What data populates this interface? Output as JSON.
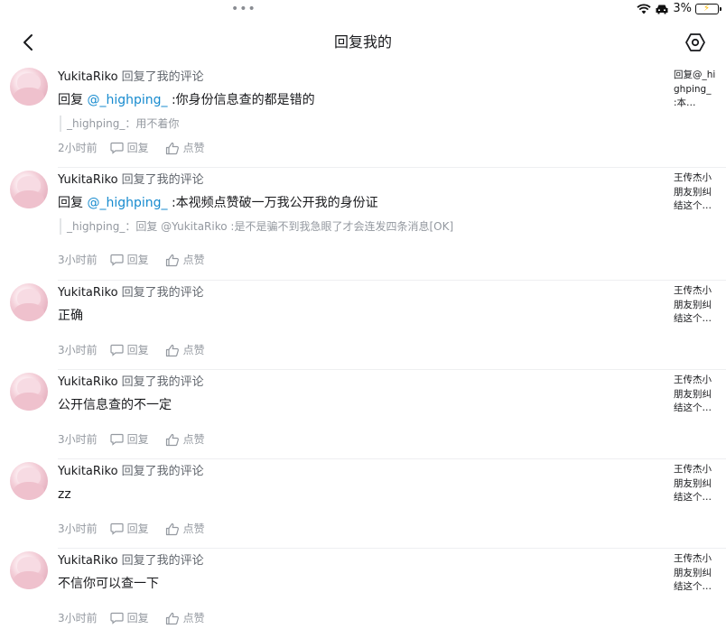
{
  "status_bar": {
    "battery_text": "3%"
  },
  "header": {
    "title": "回复我的"
  },
  "replies": [
    {
      "name": "YukitaRiko",
      "action": "回复了我的评论",
      "prefix": "回复 ",
      "mention": "@_highping_",
      "text": " :你身份信息查的都是错的",
      "quote": "_highping_：用不着你",
      "time": "2小时前",
      "reply_label": "回复",
      "like_label": "点赞",
      "preview": "回复@_highping_ :本…"
    },
    {
      "name": "YukitaRiko",
      "action": "回复了我的评论",
      "prefix": "回复 ",
      "mention": "@_highping_",
      "text": " :本视频点赞破一万我公开我的身份证",
      "quote": "_highping_：回复 @YukitaRiko :是不是骗不到我急眼了才会连发四条消息[OK]",
      "time": "3小时前",
      "reply_label": "回复",
      "like_label": "点赞",
      "preview": "王传杰小朋友别纠结这个…"
    },
    {
      "name": "YukitaRiko",
      "action": "回复了我的评论",
      "prefix": "",
      "mention": "",
      "text": "正确",
      "quote": "",
      "time": "3小时前",
      "reply_label": "回复",
      "like_label": "点赞",
      "preview": "王传杰小朋友别纠结这个…"
    },
    {
      "name": "YukitaRiko",
      "action": "回复了我的评论",
      "prefix": "",
      "mention": "",
      "text": "公开信息查的不一定",
      "quote": "",
      "time": "3小时前",
      "reply_label": "回复",
      "like_label": "点赞",
      "preview": "王传杰小朋友别纠结这个…"
    },
    {
      "name": "YukitaRiko",
      "action": "回复了我的评论",
      "prefix": "",
      "mention": "",
      "text": "zz",
      "quote": "",
      "time": "3小时前",
      "reply_label": "回复",
      "like_label": "点赞",
      "preview": "王传杰小朋友别纠结这个…"
    },
    {
      "name": "YukitaRiko",
      "action": "回复了我的评论",
      "prefix": "",
      "mention": "",
      "text": "不信你可以查一下",
      "quote": "",
      "time": "3小时前",
      "reply_label": "回复",
      "like_label": "点赞",
      "preview": "王传杰小朋友别纠结这个…"
    }
  ],
  "colors": {
    "mention": "#178bcf",
    "muted": "#9499a0",
    "separator": "#eeeff1"
  },
  "icons": [
    "back-arrow-icon",
    "settings-hexagon-icon",
    "comment-bubble-icon",
    "thumbs-up-icon",
    "wifi-icon",
    "car-icon",
    "battery-icon"
  ]
}
